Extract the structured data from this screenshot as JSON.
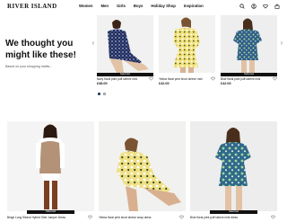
{
  "brand": {
    "logo_text": "RIVER ISLAND"
  },
  "nav": {
    "items": [
      "Women",
      "Men",
      "Girls",
      "Boys",
      "Holiday Shop",
      "Inspiration"
    ]
  },
  "header_icons": [
    "search-icon",
    "account-icon",
    "heart-icon",
    "bag-icon"
  ],
  "recommendations": {
    "title": "We thought you might like these!",
    "subtitle": "Based on your shopping habits...",
    "products": [
      {
        "name": "Navy floral print puff sleeve mini",
        "price": "£38.00",
        "badge": "Selected"
      },
      {
        "name": "Yellow floral print short sleeve mini",
        "price": "£42.00",
        "badge": ""
      },
      {
        "name": "Blue floral print puff sleeve mini",
        "price": "£42.00",
        "badge": "Selected"
      }
    ],
    "pagination": {
      "total": 2,
      "active": 1
    }
  },
  "product_grid": [
    {
      "name": "Beige Long Sleeve Hybrid Shirt Jumper Dress",
      "badge": "Selected"
    },
    {
      "name": "Yellow floral print short sleeve wrap dress",
      "badge": ""
    },
    {
      "name": "Blue floral print puff sleeve mini dress",
      "badge": "Selected"
    }
  ],
  "colors": {
    "accent": "#1a2a55",
    "badge_bg": "#111111"
  }
}
